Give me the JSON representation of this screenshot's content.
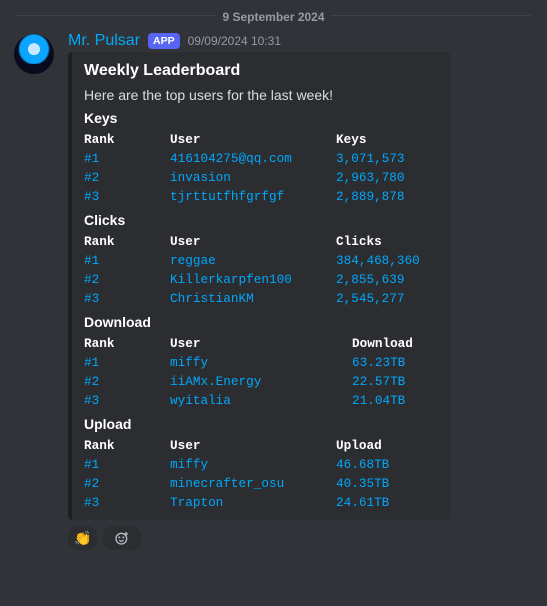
{
  "divider_date": "9 September 2024",
  "author": {
    "name": "Mr. Pulsar",
    "badge": "APP"
  },
  "timestamp": "09/09/2024 10:31",
  "embed": {
    "title": "Weekly Leaderboard",
    "description": "Here are the top users for the last week!",
    "sections": [
      {
        "title": "Keys",
        "headers": {
          "rank": "Rank",
          "user": "User",
          "value": "Keys"
        },
        "rows": [
          {
            "rank": "#1",
            "user": "416104275@qq.com",
            "value": "3,071,573"
          },
          {
            "rank": "#2",
            "user": "invasion",
            "value": "2,963,780"
          },
          {
            "rank": "#3",
            "user": "tjrttutfhfgrfgf",
            "value": "2,889,878"
          }
        ]
      },
      {
        "title": "Clicks",
        "headers": {
          "rank": "Rank",
          "user": "User",
          "value": "Clicks"
        },
        "rows": [
          {
            "rank": "#1",
            "user": "reggae",
            "value": "384,468,360"
          },
          {
            "rank": "#2",
            "user": "Killerkarpfen100",
            "value": "2,855,639"
          },
          {
            "rank": "#3",
            "user": "ChristianKM",
            "value": "2,545,277"
          }
        ]
      },
      {
        "title": "Download",
        "headers": {
          "rank": "Rank",
          "user": "User",
          "value": "Download"
        },
        "rows": [
          {
            "rank": "#1",
            "user": "miffy",
            "value": "63.23TB"
          },
          {
            "rank": "#2",
            "user": "iiAMx.Energy",
            "value": "22.57TB"
          },
          {
            "rank": "#3",
            "user": "wyitalia",
            "value": "21.04TB"
          }
        ]
      },
      {
        "title": "Upload",
        "headers": {
          "rank": "Rank",
          "user": "User",
          "value": "Upload"
        },
        "rows": [
          {
            "rank": "#1",
            "user": "miffy",
            "value": "46.68TB"
          },
          {
            "rank": "#2",
            "user": "minecrafter_osu",
            "value": "40.35TB"
          },
          {
            "rank": "#3",
            "user": "Trapton",
            "value": "24.61TB"
          }
        ]
      }
    ]
  },
  "reactions": {
    "items": [
      {
        "emoji": "👏"
      }
    ]
  }
}
